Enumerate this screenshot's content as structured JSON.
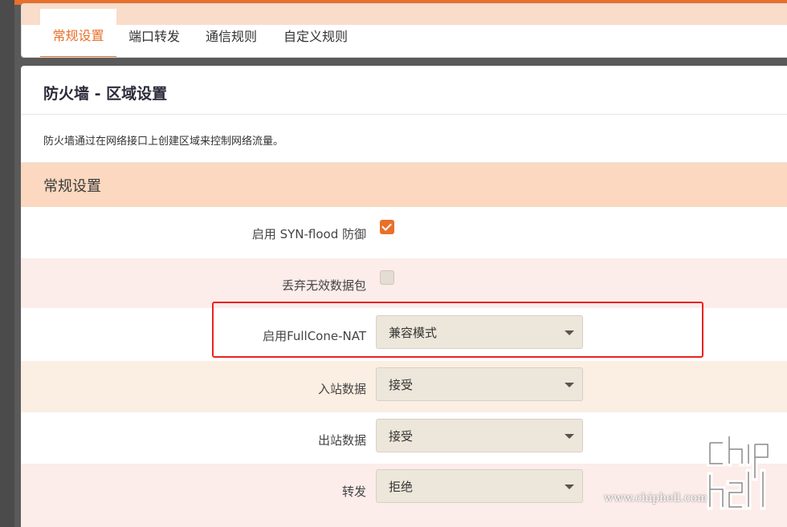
{
  "tabs": [
    {
      "label": "常规设置",
      "active": true
    },
    {
      "label": "端口转发",
      "active": false
    },
    {
      "label": "通信规则",
      "active": false
    },
    {
      "label": "自定义规则",
      "active": false
    }
  ],
  "page": {
    "title": "防火墙 - 区域设置",
    "description": "防火墙通过在网络接口上创建区域来控制网络流量。"
  },
  "section": {
    "title": "常规设置",
    "syn_flood": {
      "label": "启用 SYN-flood 防御",
      "checked": true
    },
    "drop_invalid": {
      "label": "丢弃无效数据包",
      "checked": false
    },
    "fullcone": {
      "label": "启用FullCone-NAT",
      "value": "兼容模式"
    },
    "input": {
      "label": "入站数据",
      "value": "接受"
    },
    "output": {
      "label": "出站数据",
      "value": "接受"
    },
    "forward": {
      "label": "转发",
      "value": "拒绝"
    }
  },
  "watermark": {
    "text": "www.chiphell.com"
  },
  "colors": {
    "accent": "#e8702a",
    "header_band": "#fbd8bf",
    "highlight_box": "#e8231f"
  }
}
